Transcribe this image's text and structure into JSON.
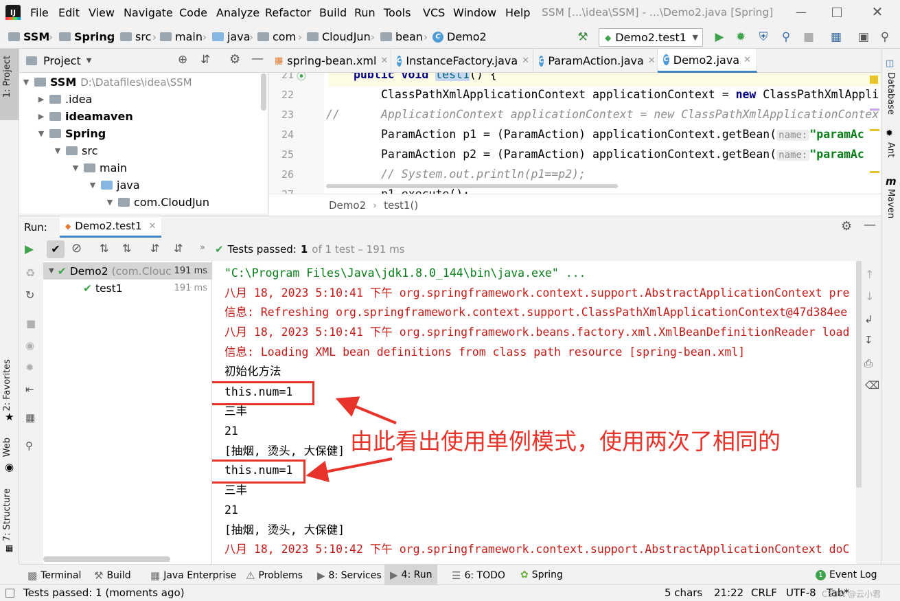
{
  "menu": {
    "items": [
      "File",
      "Edit",
      "View",
      "Navigate",
      "Code",
      "Analyze",
      "Refactor",
      "Build",
      "Run",
      "Tools",
      "VCS",
      "Window",
      "Help"
    ],
    "title": "SSM [...\\idea\\SSM] - ...\\Demo2.java [Spring]"
  },
  "navbar": {
    "crumbs": [
      "SSM",
      "Spring",
      "src",
      "main",
      "java",
      "com",
      "CloudJun",
      "bean",
      "Demo2"
    ],
    "run_config": "Demo2.test1"
  },
  "left_strip": {
    "project": "1: Project",
    "favorites": "2: Favorites",
    "web": "Web",
    "structure": "7: Structure"
  },
  "right_strip": {
    "database": "Database",
    "ant": "Ant",
    "maven": "Maven",
    "maven_glyph": "m"
  },
  "project": {
    "title": "Project",
    "tree": [
      {
        "label": "SSM",
        "path": "D:\\Datafiles\\idea\\SSM"
      },
      {
        "label": ".idea"
      },
      {
        "label": "ideamaven"
      },
      {
        "label": "Spring"
      },
      {
        "label": "src"
      },
      {
        "label": "main"
      },
      {
        "label": "java"
      },
      {
        "label": "com.CloudJun"
      }
    ]
  },
  "editor": {
    "tabs": [
      "spring-bean.xml",
      "InstanceFactory.java",
      "ParamAction.java",
      "Demo2.java"
    ],
    "active_tab": "Demo2.java",
    "line_numbers": [
      "21",
      "22",
      "23",
      "24",
      "25",
      "26",
      "27"
    ],
    "lines": {
      "l21_kw": "public void",
      "l21_name": "test1",
      "l21_rest": "() {",
      "l22_a": "ClassPathXmlApplicationContext applicationContext = ",
      "l22_kw": "new",
      "l22_b": " ClassPathXmlAppli",
      "l23_slash": "//",
      "l23_a": "ApplicationContext applicationContext = new ClassPathXmlApplicationContex",
      "l24_a": "ParamAction p1 = (ParamAction) applicationContext.getBean(",
      "l25_a": "ParamAction p2 = (ParamAction) applicationContext.getBean(",
      "hint_name": "name:",
      "hint_str": "\"paramAc",
      "l26": "// System.out.println(p1==p2);",
      "l27": "p1.execute();"
    },
    "breadcrumb": [
      "Demo2",
      "test1()"
    ]
  },
  "run": {
    "label": "Run:",
    "tab": "Demo2.test1",
    "status_prefix": "Tests passed:",
    "status_count": "1",
    "status_suffix": "of 1 test – 191 ms",
    "tree": [
      {
        "name": "Demo2",
        "detail": "(com.Clouc",
        "time": "191 ms"
      },
      {
        "name": "test1",
        "time": "191 ms"
      }
    ]
  },
  "console": {
    "lines": [
      "\"C:\\Program Files\\Java\\jdk1.8.0_144\\bin\\java.exe\" ...",
      "八月 18, 2023 5:10:41 下午 org.springframework.context.support.AbstractApplicationContext pre",
      "信息: Refreshing org.springframework.context.support.ClassPathXmlApplicationContext@47d384ee",
      "八月 18, 2023 5:10:41 下午 org.springframework.beans.factory.xml.XmlBeanDefinitionReader load",
      "信息: Loading XML bean definitions from class path resource [spring-bean.xml]",
      "初始化方法",
      "this.num=1",
      "三丰",
      "21",
      "[抽烟, 烫头, 大保健]",
      "this.num=1",
      "三丰",
      "21",
      "[抽烟, 烫头, 大保健]",
      "八月 18, 2023 5:10:42 下午 org.springframework.context.support.AbstractApplicationContext doC"
    ],
    "annotation": "由此看出使用单例模式，使用两次了相同的"
  },
  "bottom_tabs": [
    "Terminal",
    "Build",
    "Java Enterprise",
    "Problems",
    "8: Services",
    "4: Run",
    "6: TODO",
    "Spring"
  ],
  "event_log": "Event Log",
  "event_count": "1",
  "status": {
    "message": "Tests passed: 1 (moments ago)",
    "chars": "5 chars",
    "position": "21:22",
    "line_sep": "CRLF",
    "encoding": "UTF-8",
    "indent": "Tab*",
    "watermark": "CSDN @云小君"
  },
  "colors": {
    "accent": "#4083c9",
    "annotation_red": "#e8332a",
    "success_green": "#3fa34d"
  }
}
